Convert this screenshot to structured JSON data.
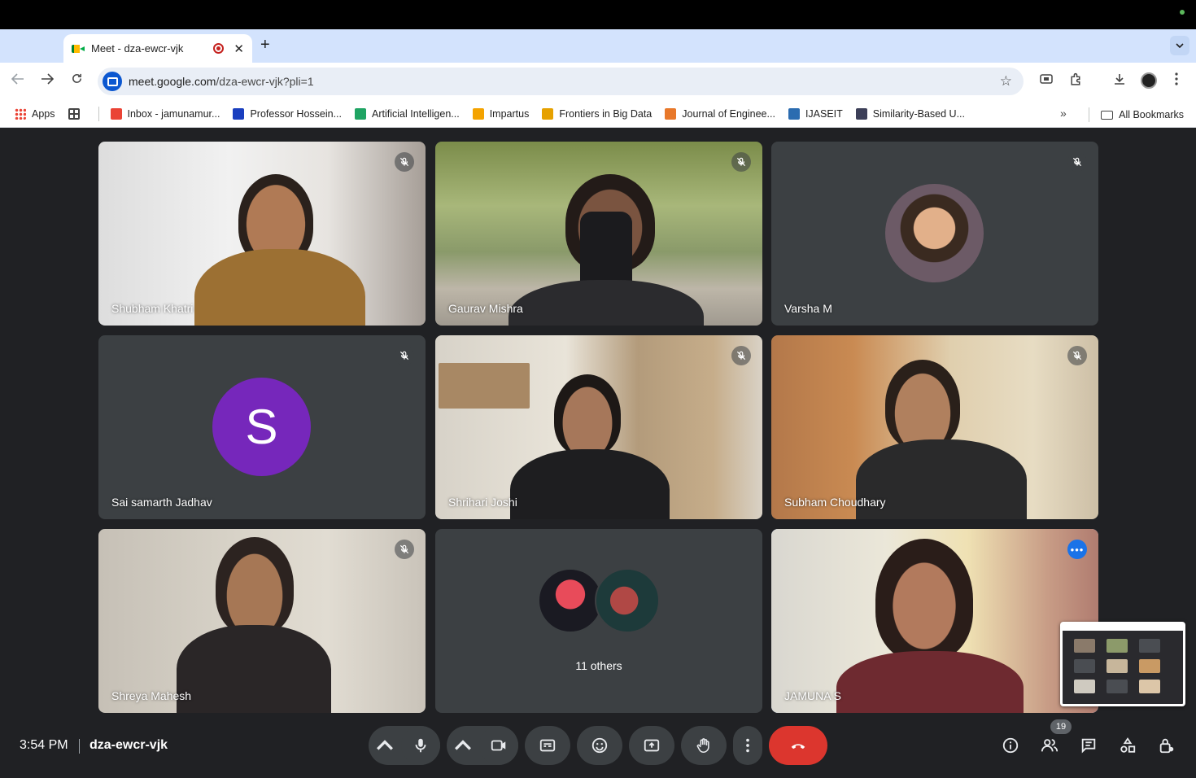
{
  "browser": {
    "tab_title": "Meet - dza-ewcr-vjk",
    "url_host": "meet.google.com",
    "url_path": "/dza-ewcr-vjk?pli=1",
    "new_tab_label": "+",
    "tab_close": "✕"
  },
  "bookmarks": {
    "apps": "Apps",
    "items": [
      {
        "label": "Inbox - jamunamur...",
        "icon": "gmail-icon",
        "color": "#ea4335"
      },
      {
        "label": "Professor Hossein...",
        "icon": "s-icon",
        "color": "#1a3fbf"
      },
      {
        "label": "Artificial Intelligen...",
        "icon": "drive-icon",
        "color": "#1fa463"
      },
      {
        "label": "Impartus",
        "icon": "impartus-icon",
        "color": "#f4a300"
      },
      {
        "label": "Frontiers in Big Data",
        "icon": "frontiers-icon",
        "color": "#e6a100"
      },
      {
        "label": "Journal of Enginee...",
        "icon": "sjr-icon",
        "color": "#e8782a"
      },
      {
        "label": "IJASEIT",
        "icon": "ijaseit-icon",
        "color": "#2b6cb0"
      },
      {
        "label": "Similarity-Based U...",
        "icon": "similarity-icon",
        "color": "#3c3f58"
      }
    ],
    "more": "»",
    "all_bookmarks": "All Bookmarks"
  },
  "participants": [
    {
      "name": "Shubham Khatri",
      "muted": true,
      "type": "video"
    },
    {
      "name": "Gaurav Mishra",
      "muted": true,
      "type": "video"
    },
    {
      "name": "Varsha M",
      "muted": true,
      "type": "photo"
    },
    {
      "name": "Sai samarth Jadhav",
      "muted": true,
      "type": "letter",
      "letter": "S",
      "avatar_color": "#7627bb"
    },
    {
      "name": "Shrihari Joshi",
      "muted": true,
      "type": "video"
    },
    {
      "name": "Subham Choudhary",
      "muted": true,
      "type": "video"
    },
    {
      "name": "Shreya Mahesh",
      "muted": true,
      "type": "video"
    },
    {
      "name": "JAMUNA S",
      "muted": false,
      "type": "video",
      "active_speaker": true
    }
  ],
  "others": {
    "label": "11 others"
  },
  "bottom": {
    "time": "3:54 PM",
    "meeting_code": "dza-ewcr-vjk",
    "participants_count": "19"
  },
  "colors": {
    "end_call": "#dc362e",
    "active_outline": "#8ab4f8",
    "tile_bg": "#3c4043",
    "stage_bg": "#202124"
  }
}
